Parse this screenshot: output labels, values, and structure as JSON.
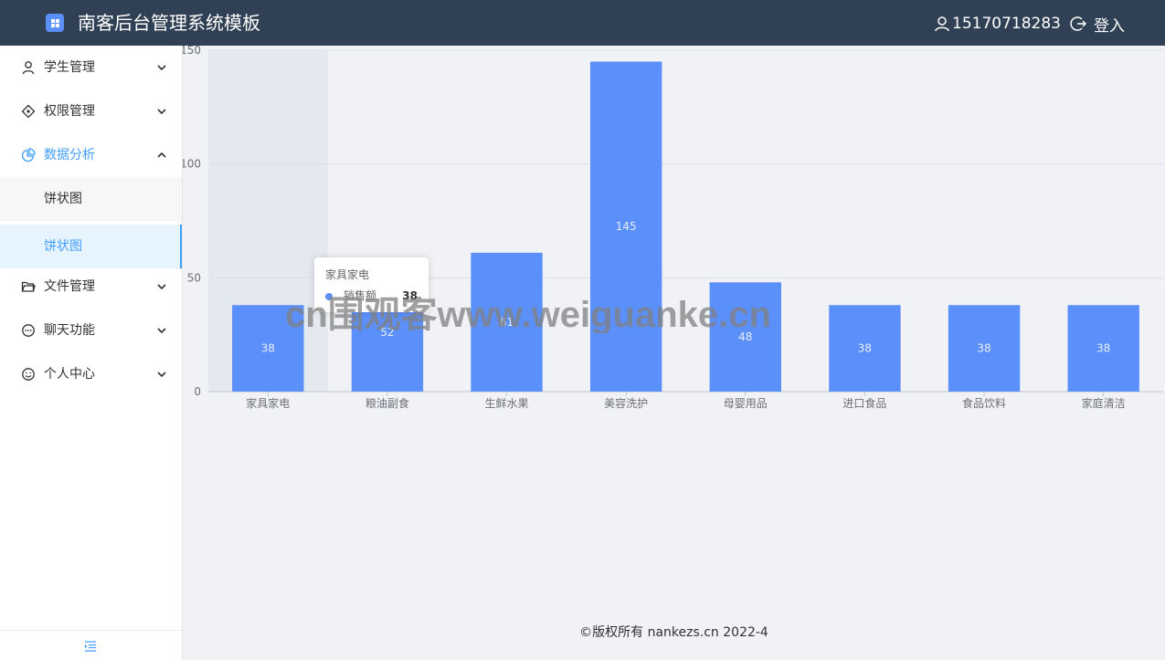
{
  "header": {
    "title": "南客后台管理系统模板",
    "user_phone": "15170718283",
    "login_label": "登入"
  },
  "sidebar": {
    "items": [
      {
        "label": "学生管理",
        "icon": "user-icon"
      },
      {
        "label": "权限管理",
        "icon": "permission-icon"
      },
      {
        "label": "数据分析",
        "icon": "pie-chart-icon"
      },
      {
        "label": "文件管理",
        "icon": "folder-icon"
      },
      {
        "label": "聊天功能",
        "icon": "chat-icon"
      },
      {
        "label": "个人中心",
        "icon": "smile-icon"
      }
    ],
    "sub_items": [
      {
        "label": "饼状图"
      },
      {
        "label": "饼状图"
      }
    ]
  },
  "chart_data": {
    "type": "bar",
    "categories": [
      "家具家电",
      "粮油副食",
      "生鲜水果",
      "美容洗护",
      "母婴用品",
      "进口食品",
      "食品饮料",
      "家庭清洁"
    ],
    "series": [
      {
        "name": "销售额",
        "values": [
          38,
          52,
          61,
          145,
          48,
          38,
          38,
          38
        ]
      }
    ],
    "ylim": [
      0,
      150
    ],
    "yticks": [
      0,
      50,
      100,
      150
    ],
    "grid": true,
    "bar_color": "#5b8ff9",
    "highlighted_category": "家具家电"
  },
  "tooltip": {
    "title": "家具家电",
    "label": "销售额",
    "value": "38"
  },
  "watermark": "cn围观客www.weiguanke.cn",
  "footer": "©版权所有 nankezs.cn 2022-4",
  "colors": {
    "topbar": "#304156",
    "accent": "#409eff",
    "bar": "#5b8ff9"
  }
}
